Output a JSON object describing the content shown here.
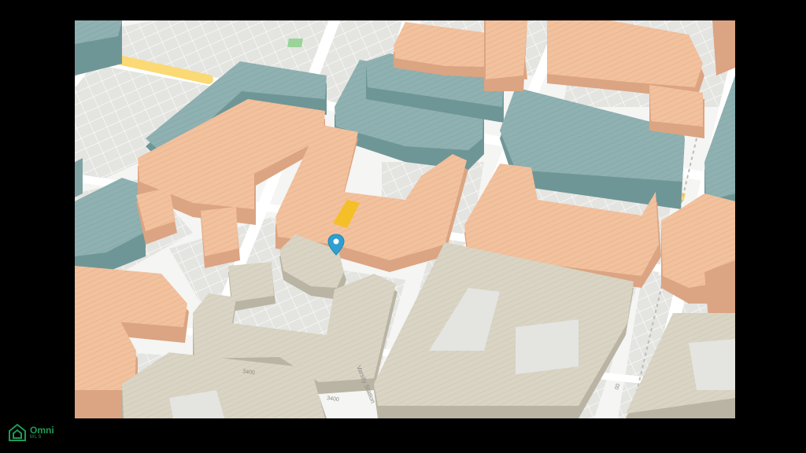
{
  "map": {
    "colors": {
      "background": "#f5f5f3",
      "block_ground": "#e4e4e1",
      "parcel_line": "#ffffff",
      "street": "#ffffff",
      "highlight_street": "#fbd974",
      "highlight_segment": "#f5bf27",
      "park": "#9bd39a",
      "residential": "#f2c19d",
      "residential_dark": "#dba482",
      "commercial": "#8fb1b1",
      "commercial_dark": "#6f9696",
      "civic": "#d9d4c3",
      "civic_dark": "#b9b4a3",
      "pin": "#2f9fd1",
      "label": "#8a8a86"
    },
    "street_labels": [
      {
        "name": "street-label-vertical",
        "text": "Varsity Station"
      },
      {
        "name": "street-label-number-a",
        "text": "3400"
      },
      {
        "name": "street-label-number-b",
        "text": "3400"
      },
      {
        "name": "street-label-number-c",
        "text": "00"
      }
    ],
    "pin_icon": "map-pin-icon"
  },
  "brand": {
    "name": "Omni",
    "sub": "MLS",
    "icon": "house-icon"
  }
}
